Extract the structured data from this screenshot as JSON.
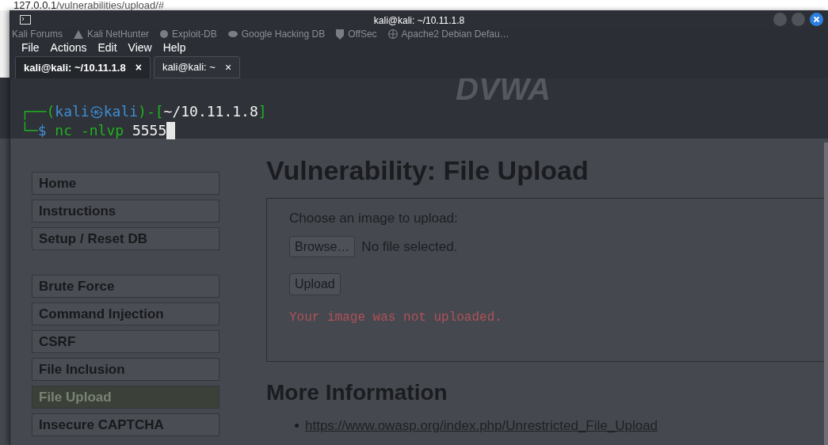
{
  "browser": {
    "url_host": "127.0.0.1",
    "url_path": "/vulnerabilities/upload/#",
    "bookmarks": [
      {
        "label": "Kali Forums"
      },
      {
        "label": "Kali NetHunter"
      },
      {
        "label": "Exploit-DB"
      },
      {
        "label": "Google Hacking DB"
      },
      {
        "label": "OffSec"
      },
      {
        "label": "Apache2 Debian Defau…"
      }
    ]
  },
  "page": {
    "logo": "DVWA",
    "menu_groups": [
      [
        {
          "label": "Home",
          "selected": false
        },
        {
          "label": "Instructions",
          "selected": false
        },
        {
          "label": "Setup / Reset DB",
          "selected": false
        }
      ],
      [
        {
          "label": "Brute Force",
          "selected": false
        },
        {
          "label": "Command Injection",
          "selected": false
        },
        {
          "label": "CSRF",
          "selected": false
        },
        {
          "label": "File Inclusion",
          "selected": false
        },
        {
          "label": "File Upload",
          "selected": true
        },
        {
          "label": "Insecure CAPTCHA",
          "selected": false
        }
      ]
    ],
    "heading": "Vulnerability: File Upload",
    "upload_prompt": "Choose an image to upload:",
    "browse_button": "Browse…",
    "file_status": "No file selected.",
    "upload_button": "Upload",
    "message": "Your image was not uploaded.",
    "more_heading": "More Information",
    "links": [
      "https://www.owasp.org/index.php/Unrestricted_File_Upload"
    ]
  },
  "terminal": {
    "title": "kali@kali: ~/10.11.1.8",
    "menu": [
      "File",
      "Actions",
      "Edit",
      "View",
      "Help"
    ],
    "tabs": [
      {
        "label": "kali@kali: ~/10.11.1.8",
        "close": "×",
        "selected": true
      },
      {
        "label": "kali@kali: ~",
        "close": "×",
        "selected": false
      }
    ],
    "lines": [
      [
        {
          "kind": "frame",
          "text": "┌──("
        },
        {
          "kind": "user",
          "text": "kali㉿kali"
        },
        {
          "kind": "frame",
          "text": ")-["
        },
        {
          "kind": "path",
          "text": "~/10.11.1.8"
        },
        {
          "kind": "frame",
          "text": "]"
        }
      ],
      [
        {
          "kind": "frame",
          "text": "└─"
        },
        {
          "kind": "user",
          "text": "$"
        },
        {
          "kind": "command",
          "text": " nc -nlvp"
        },
        {
          "kind": "path",
          "text": " 5555"
        }
      ]
    ]
  }
}
